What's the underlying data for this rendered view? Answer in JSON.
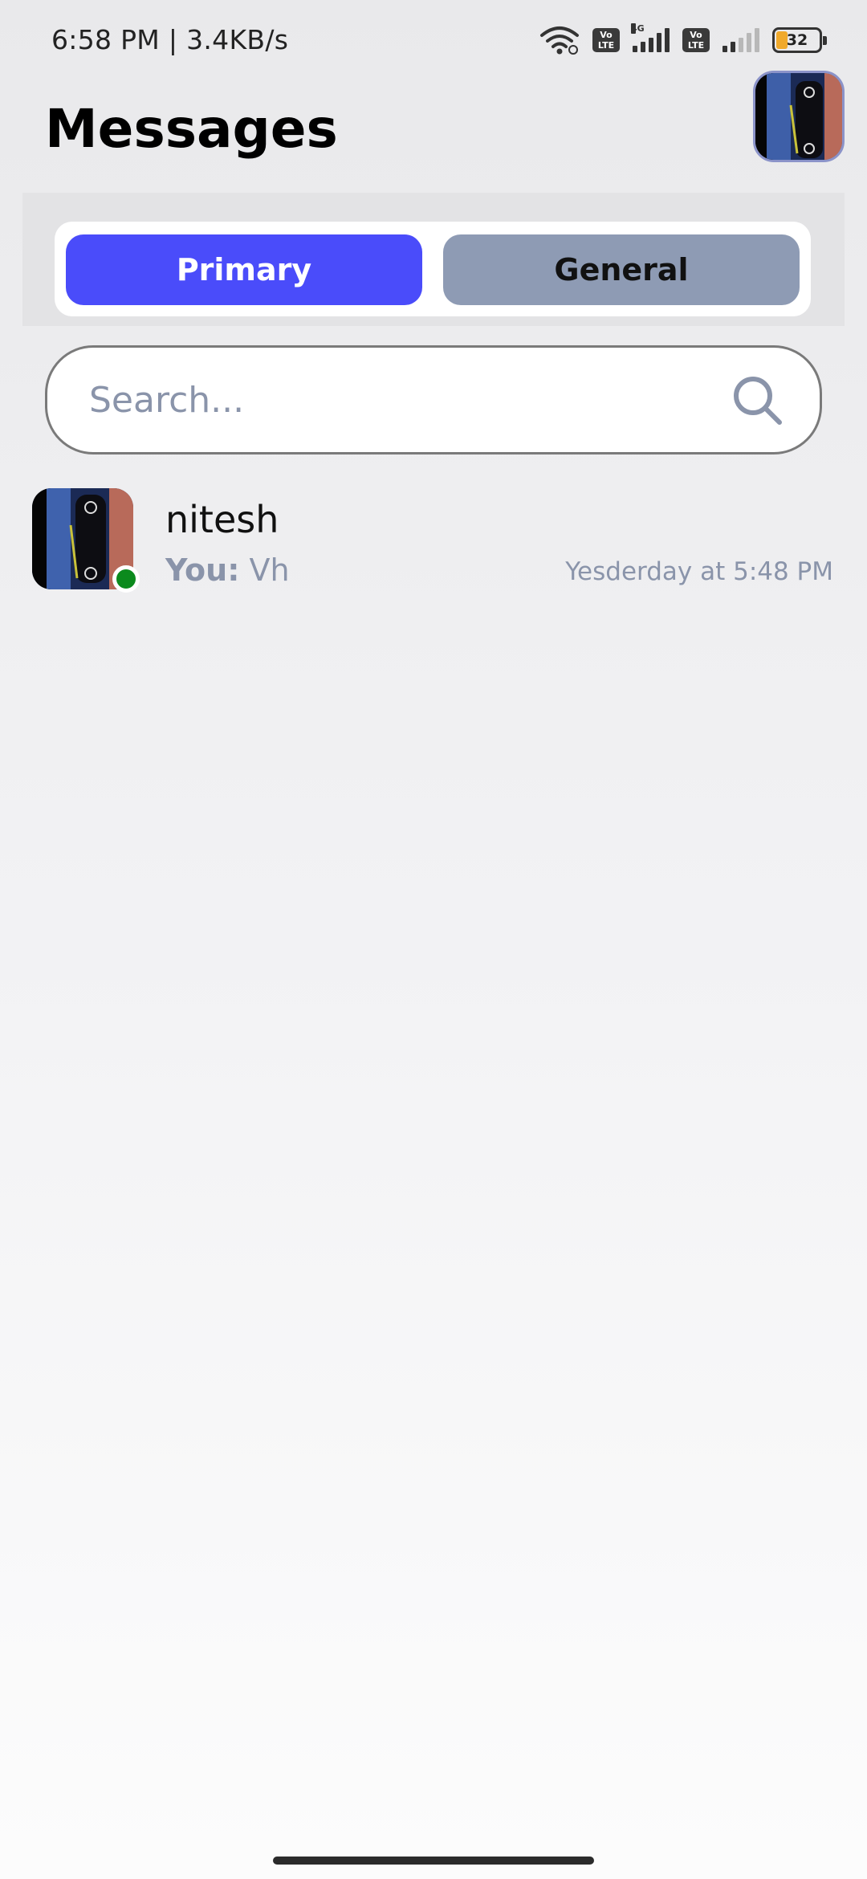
{
  "status_bar": {
    "time_speed": "6:58 PM | 3.4KB/s",
    "volte_label": "Vo LTE",
    "network_type": "4G",
    "battery_level": "32",
    "battery_color": "#f0a92b"
  },
  "header": {
    "title": "Messages",
    "profile_avatar_alt": "profile photo"
  },
  "tabs": [
    {
      "label": "Primary",
      "active": true,
      "color": "#4a4cfa"
    },
    {
      "label": "General",
      "active": false,
      "color": "#8e9bb4"
    }
  ],
  "search": {
    "placeholder": "Search...",
    "value": ""
  },
  "conversations": [
    {
      "name": "nitesh",
      "sender_prefix": "You:",
      "last_message": "Vh",
      "timestamp": "Yesderday at 5:48 PM",
      "online": true,
      "online_color": "#0b8a1d"
    }
  ]
}
